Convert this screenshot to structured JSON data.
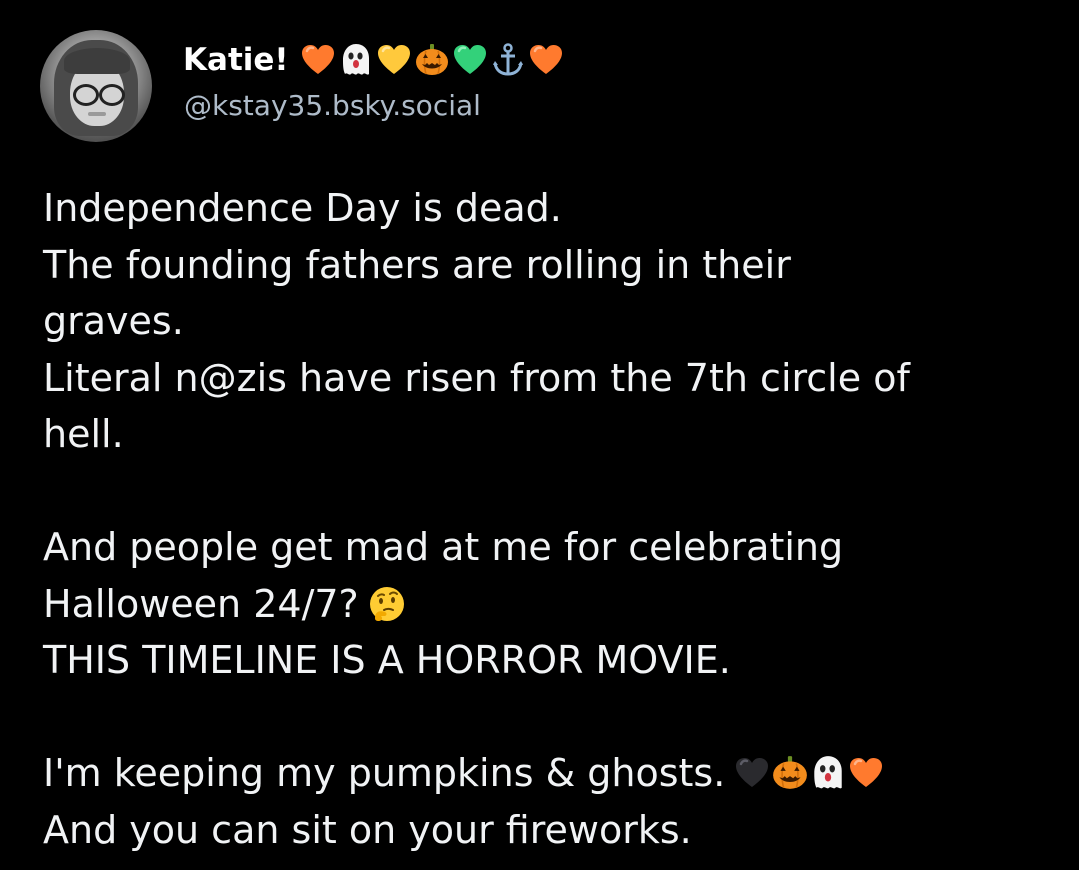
{
  "post": {
    "author": {
      "display_name": "Katie!",
      "handle": "@kstay35.bsky.social",
      "name_emoji": [
        "orange-heart",
        "ghost",
        "yellow-heart",
        "jack-o-lantern",
        "green-heart",
        "anchor",
        "orange-heart"
      ]
    },
    "lines": [
      "Independence Day is dead.",
      "The founding fathers are rolling in their",
      "graves.",
      "Literal n@zis have risen from the 7th circle of",
      "hell.",
      "",
      "And people get mad at me for celebrating",
      "Halloween 24/7?",
      "THIS TIMELINE IS A HORROR MOVIE.",
      "",
      "I'm keeping my pumpkins & ghosts.",
      "And you can sit on your fireworks."
    ],
    "inline_emoji": {
      "halloween_line": [
        "thinking-face"
      ],
      "pumpkins_line": [
        "black-heart",
        "jack-o-lantern",
        "ghost",
        "orange-heart"
      ]
    }
  },
  "colors": {
    "background": "#000000",
    "text": "#f1f3f5",
    "handle": "#aebbc9",
    "orange_heart": "#ff7a2e",
    "yellow_heart": "#ffc93c",
    "green_heart": "#33d17a",
    "anchor": "#8fb3d6",
    "pumpkin": "#f28c1c"
  }
}
